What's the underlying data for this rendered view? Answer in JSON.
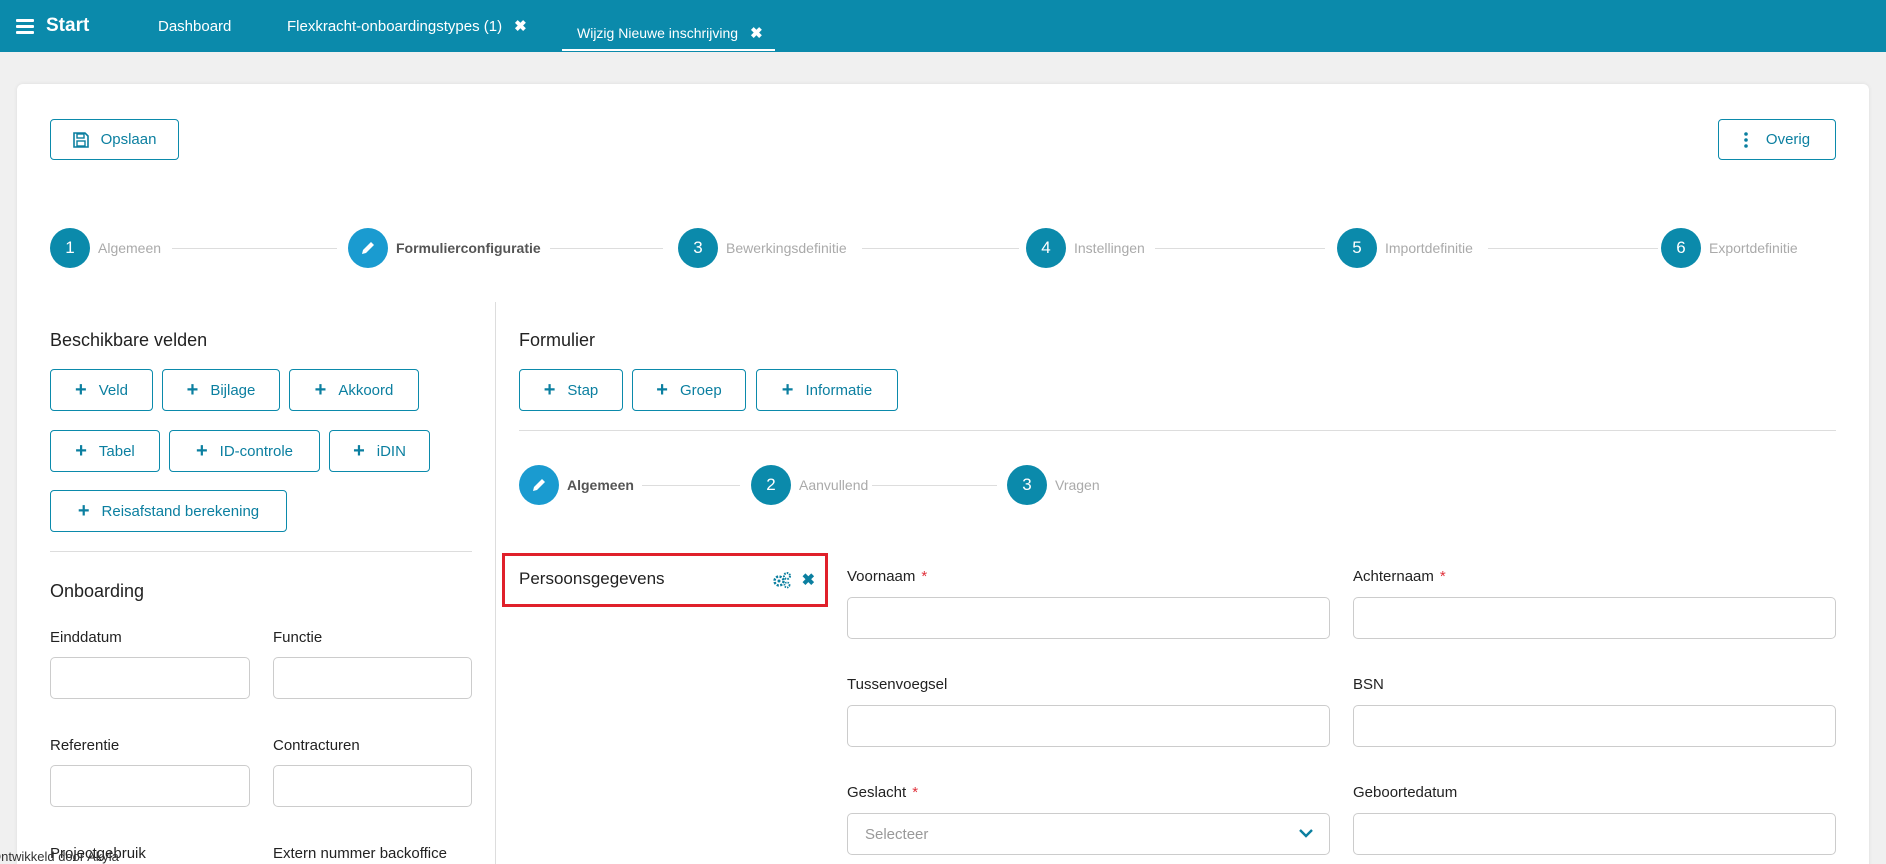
{
  "topbar": {
    "brand": "Start",
    "tabs": [
      {
        "label": "Dashboard"
      },
      {
        "label": "Flexkracht-onboardingstypes (1)"
      },
      {
        "label": "Wijzig Nieuwe inschrijving"
      }
    ]
  },
  "toolbar": {
    "save_label": "Opslaan",
    "more_label": "Overig"
  },
  "main_steps": [
    {
      "number": "1",
      "label": "Algemeen"
    },
    {
      "number": "",
      "label": "Formulierconfiguratie"
    },
    {
      "number": "3",
      "label": "Bewerkingsdefinitie"
    },
    {
      "number": "4",
      "label": "Instellingen"
    },
    {
      "number": "5",
      "label": "Importdefinitie"
    },
    {
      "number": "6",
      "label": "Exportdefinitie"
    }
  ],
  "available_fields": {
    "title": "Beschikbare velden",
    "buttons": [
      "Veld",
      "Bijlage",
      "Akkoord",
      "Tabel",
      "ID-controle",
      "iDIN",
      "Reisafstand berekening"
    ]
  },
  "onboarding": {
    "title": "Onboarding",
    "fields": [
      "Einddatum",
      "Functie",
      "Referentie",
      "Contracturen",
      "Projectgebruik",
      "Extern nummer backoffice"
    ]
  },
  "form": {
    "title": "Formulier",
    "buttons": [
      "Stap",
      "Groep",
      "Informatie"
    ],
    "steps": [
      {
        "number": "",
        "label": "Algemeen"
      },
      {
        "number": "2",
        "label": "Aanvullend"
      },
      {
        "number": "3",
        "label": "Vragen"
      }
    ],
    "group_title": "Persoonsgegevens",
    "fields": {
      "voornaam": "Voornaam",
      "achternaam": "Achternaam",
      "tussenvoegsel": "Tussenvoegsel",
      "bsn": "BSN",
      "geslacht": "Geslacht",
      "geslacht_placeholder": "Selecteer",
      "geboortedatum": "Geboortedatum",
      "required_mark": "*"
    }
  },
  "footer": {
    "text": "Ontwikkeld door Akyla"
  },
  "colors": {
    "accent": "#0b8aab",
    "active_step": "#1a9bd0",
    "required": "#e0313b",
    "highlight": "#e0202a"
  }
}
